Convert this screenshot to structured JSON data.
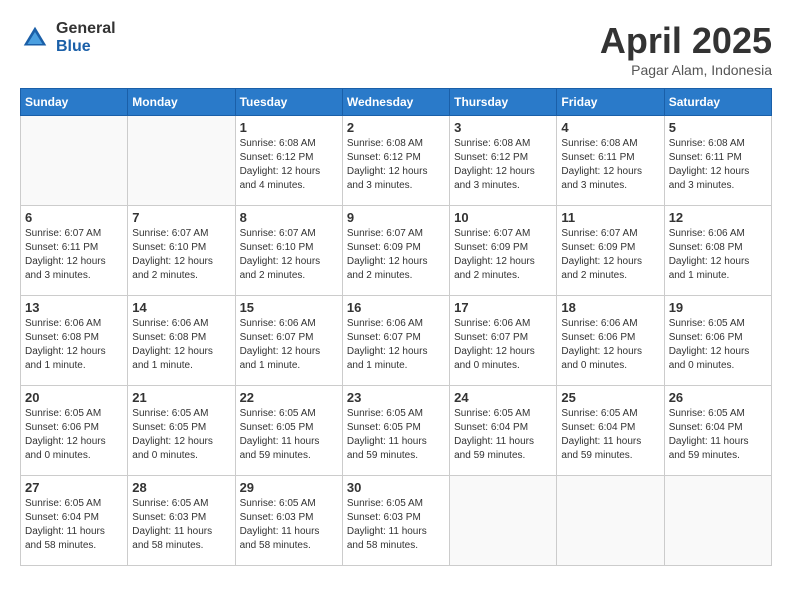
{
  "header": {
    "logo_general": "General",
    "logo_blue": "Blue",
    "month_title": "April 2025",
    "location": "Pagar Alam, Indonesia"
  },
  "weekdays": [
    "Sunday",
    "Monday",
    "Tuesday",
    "Wednesday",
    "Thursday",
    "Friday",
    "Saturday"
  ],
  "weeks": [
    [
      {
        "day": "",
        "info": ""
      },
      {
        "day": "",
        "info": ""
      },
      {
        "day": "1",
        "info": "Sunrise: 6:08 AM\nSunset: 6:12 PM\nDaylight: 12 hours\nand 4 minutes."
      },
      {
        "day": "2",
        "info": "Sunrise: 6:08 AM\nSunset: 6:12 PM\nDaylight: 12 hours\nand 3 minutes."
      },
      {
        "day": "3",
        "info": "Sunrise: 6:08 AM\nSunset: 6:12 PM\nDaylight: 12 hours\nand 3 minutes."
      },
      {
        "day": "4",
        "info": "Sunrise: 6:08 AM\nSunset: 6:11 PM\nDaylight: 12 hours\nand 3 minutes."
      },
      {
        "day": "5",
        "info": "Sunrise: 6:08 AM\nSunset: 6:11 PM\nDaylight: 12 hours\nand 3 minutes."
      }
    ],
    [
      {
        "day": "6",
        "info": "Sunrise: 6:07 AM\nSunset: 6:11 PM\nDaylight: 12 hours\nand 3 minutes."
      },
      {
        "day": "7",
        "info": "Sunrise: 6:07 AM\nSunset: 6:10 PM\nDaylight: 12 hours\nand 2 minutes."
      },
      {
        "day": "8",
        "info": "Sunrise: 6:07 AM\nSunset: 6:10 PM\nDaylight: 12 hours\nand 2 minutes."
      },
      {
        "day": "9",
        "info": "Sunrise: 6:07 AM\nSunset: 6:09 PM\nDaylight: 12 hours\nand 2 minutes."
      },
      {
        "day": "10",
        "info": "Sunrise: 6:07 AM\nSunset: 6:09 PM\nDaylight: 12 hours\nand 2 minutes."
      },
      {
        "day": "11",
        "info": "Sunrise: 6:07 AM\nSunset: 6:09 PM\nDaylight: 12 hours\nand 2 minutes."
      },
      {
        "day": "12",
        "info": "Sunrise: 6:06 AM\nSunset: 6:08 PM\nDaylight: 12 hours\nand 1 minute."
      }
    ],
    [
      {
        "day": "13",
        "info": "Sunrise: 6:06 AM\nSunset: 6:08 PM\nDaylight: 12 hours\nand 1 minute."
      },
      {
        "day": "14",
        "info": "Sunrise: 6:06 AM\nSunset: 6:08 PM\nDaylight: 12 hours\nand 1 minute."
      },
      {
        "day": "15",
        "info": "Sunrise: 6:06 AM\nSunset: 6:07 PM\nDaylight: 12 hours\nand 1 minute."
      },
      {
        "day": "16",
        "info": "Sunrise: 6:06 AM\nSunset: 6:07 PM\nDaylight: 12 hours\nand 1 minute."
      },
      {
        "day": "17",
        "info": "Sunrise: 6:06 AM\nSunset: 6:07 PM\nDaylight: 12 hours\nand 0 minutes."
      },
      {
        "day": "18",
        "info": "Sunrise: 6:06 AM\nSunset: 6:06 PM\nDaylight: 12 hours\nand 0 minutes."
      },
      {
        "day": "19",
        "info": "Sunrise: 6:05 AM\nSunset: 6:06 PM\nDaylight: 12 hours\nand 0 minutes."
      }
    ],
    [
      {
        "day": "20",
        "info": "Sunrise: 6:05 AM\nSunset: 6:06 PM\nDaylight: 12 hours\nand 0 minutes."
      },
      {
        "day": "21",
        "info": "Sunrise: 6:05 AM\nSunset: 6:05 PM\nDaylight: 12 hours\nand 0 minutes."
      },
      {
        "day": "22",
        "info": "Sunrise: 6:05 AM\nSunset: 6:05 PM\nDaylight: 11 hours\nand 59 minutes."
      },
      {
        "day": "23",
        "info": "Sunrise: 6:05 AM\nSunset: 6:05 PM\nDaylight: 11 hours\nand 59 minutes."
      },
      {
        "day": "24",
        "info": "Sunrise: 6:05 AM\nSunset: 6:04 PM\nDaylight: 11 hours\nand 59 minutes."
      },
      {
        "day": "25",
        "info": "Sunrise: 6:05 AM\nSunset: 6:04 PM\nDaylight: 11 hours\nand 59 minutes."
      },
      {
        "day": "26",
        "info": "Sunrise: 6:05 AM\nSunset: 6:04 PM\nDaylight: 11 hours\nand 59 minutes."
      }
    ],
    [
      {
        "day": "27",
        "info": "Sunrise: 6:05 AM\nSunset: 6:04 PM\nDaylight: 11 hours\nand 58 minutes."
      },
      {
        "day": "28",
        "info": "Sunrise: 6:05 AM\nSunset: 6:03 PM\nDaylight: 11 hours\nand 58 minutes."
      },
      {
        "day": "29",
        "info": "Sunrise: 6:05 AM\nSunset: 6:03 PM\nDaylight: 11 hours\nand 58 minutes."
      },
      {
        "day": "30",
        "info": "Sunrise: 6:05 AM\nSunset: 6:03 PM\nDaylight: 11 hours\nand 58 minutes."
      },
      {
        "day": "",
        "info": ""
      },
      {
        "day": "",
        "info": ""
      },
      {
        "day": "",
        "info": ""
      }
    ]
  ]
}
